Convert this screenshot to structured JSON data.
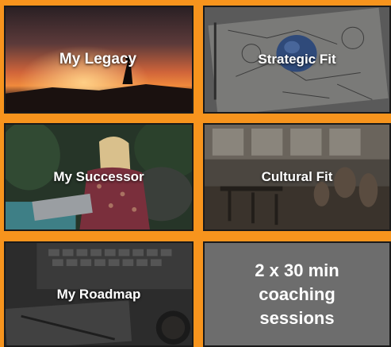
{
  "colors": {
    "accent": "#f7941d",
    "border": "#1a1a1a",
    "coaching_tile": "#6d6d6d",
    "label_text": "#ffffff"
  },
  "tiles": [
    {
      "label": "My Legacy",
      "image": "sunset-silhouette-photo"
    },
    {
      "label": "Strategic Fit",
      "image": "strategy-sketch-photo"
    },
    {
      "label": "My Successor",
      "image": "woman-laptop-photo"
    },
    {
      "label": "Cultural Fit",
      "image": "office-meeting-photo"
    },
    {
      "label": "My Roadmap",
      "image": "keyboard-desk-photo"
    },
    {
      "label": "2 x 30 min coaching sessions",
      "image": ""
    }
  ]
}
